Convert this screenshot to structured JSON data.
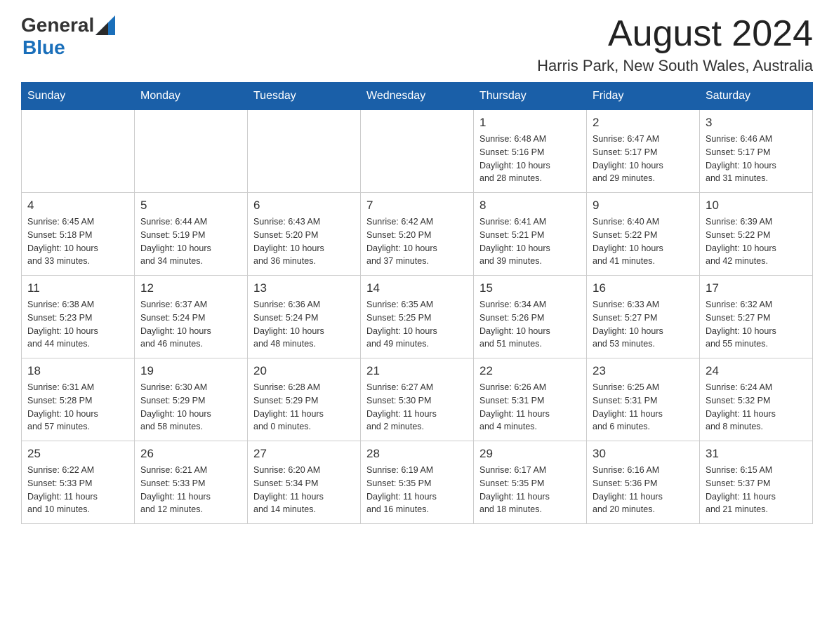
{
  "header": {
    "logo_general": "General",
    "logo_blue": "Blue",
    "month_title": "August 2024",
    "location": "Harris Park, New South Wales, Australia"
  },
  "weekdays": [
    "Sunday",
    "Monday",
    "Tuesday",
    "Wednesday",
    "Thursday",
    "Friday",
    "Saturday"
  ],
  "weeks": [
    [
      {
        "day": "",
        "info": ""
      },
      {
        "day": "",
        "info": ""
      },
      {
        "day": "",
        "info": ""
      },
      {
        "day": "",
        "info": ""
      },
      {
        "day": "1",
        "info": "Sunrise: 6:48 AM\nSunset: 5:16 PM\nDaylight: 10 hours\nand 28 minutes."
      },
      {
        "day": "2",
        "info": "Sunrise: 6:47 AM\nSunset: 5:17 PM\nDaylight: 10 hours\nand 29 minutes."
      },
      {
        "day": "3",
        "info": "Sunrise: 6:46 AM\nSunset: 5:17 PM\nDaylight: 10 hours\nand 31 minutes."
      }
    ],
    [
      {
        "day": "4",
        "info": "Sunrise: 6:45 AM\nSunset: 5:18 PM\nDaylight: 10 hours\nand 33 minutes."
      },
      {
        "day": "5",
        "info": "Sunrise: 6:44 AM\nSunset: 5:19 PM\nDaylight: 10 hours\nand 34 minutes."
      },
      {
        "day": "6",
        "info": "Sunrise: 6:43 AM\nSunset: 5:20 PM\nDaylight: 10 hours\nand 36 minutes."
      },
      {
        "day": "7",
        "info": "Sunrise: 6:42 AM\nSunset: 5:20 PM\nDaylight: 10 hours\nand 37 minutes."
      },
      {
        "day": "8",
        "info": "Sunrise: 6:41 AM\nSunset: 5:21 PM\nDaylight: 10 hours\nand 39 minutes."
      },
      {
        "day": "9",
        "info": "Sunrise: 6:40 AM\nSunset: 5:22 PM\nDaylight: 10 hours\nand 41 minutes."
      },
      {
        "day": "10",
        "info": "Sunrise: 6:39 AM\nSunset: 5:22 PM\nDaylight: 10 hours\nand 42 minutes."
      }
    ],
    [
      {
        "day": "11",
        "info": "Sunrise: 6:38 AM\nSunset: 5:23 PM\nDaylight: 10 hours\nand 44 minutes."
      },
      {
        "day": "12",
        "info": "Sunrise: 6:37 AM\nSunset: 5:24 PM\nDaylight: 10 hours\nand 46 minutes."
      },
      {
        "day": "13",
        "info": "Sunrise: 6:36 AM\nSunset: 5:24 PM\nDaylight: 10 hours\nand 48 minutes."
      },
      {
        "day": "14",
        "info": "Sunrise: 6:35 AM\nSunset: 5:25 PM\nDaylight: 10 hours\nand 49 minutes."
      },
      {
        "day": "15",
        "info": "Sunrise: 6:34 AM\nSunset: 5:26 PM\nDaylight: 10 hours\nand 51 minutes."
      },
      {
        "day": "16",
        "info": "Sunrise: 6:33 AM\nSunset: 5:27 PM\nDaylight: 10 hours\nand 53 minutes."
      },
      {
        "day": "17",
        "info": "Sunrise: 6:32 AM\nSunset: 5:27 PM\nDaylight: 10 hours\nand 55 minutes."
      }
    ],
    [
      {
        "day": "18",
        "info": "Sunrise: 6:31 AM\nSunset: 5:28 PM\nDaylight: 10 hours\nand 57 minutes."
      },
      {
        "day": "19",
        "info": "Sunrise: 6:30 AM\nSunset: 5:29 PM\nDaylight: 10 hours\nand 58 minutes."
      },
      {
        "day": "20",
        "info": "Sunrise: 6:28 AM\nSunset: 5:29 PM\nDaylight: 11 hours\nand 0 minutes."
      },
      {
        "day": "21",
        "info": "Sunrise: 6:27 AM\nSunset: 5:30 PM\nDaylight: 11 hours\nand 2 minutes."
      },
      {
        "day": "22",
        "info": "Sunrise: 6:26 AM\nSunset: 5:31 PM\nDaylight: 11 hours\nand 4 minutes."
      },
      {
        "day": "23",
        "info": "Sunrise: 6:25 AM\nSunset: 5:31 PM\nDaylight: 11 hours\nand 6 minutes."
      },
      {
        "day": "24",
        "info": "Sunrise: 6:24 AM\nSunset: 5:32 PM\nDaylight: 11 hours\nand 8 minutes."
      }
    ],
    [
      {
        "day": "25",
        "info": "Sunrise: 6:22 AM\nSunset: 5:33 PM\nDaylight: 11 hours\nand 10 minutes."
      },
      {
        "day": "26",
        "info": "Sunrise: 6:21 AM\nSunset: 5:33 PM\nDaylight: 11 hours\nand 12 minutes."
      },
      {
        "day": "27",
        "info": "Sunrise: 6:20 AM\nSunset: 5:34 PM\nDaylight: 11 hours\nand 14 minutes."
      },
      {
        "day": "28",
        "info": "Sunrise: 6:19 AM\nSunset: 5:35 PM\nDaylight: 11 hours\nand 16 minutes."
      },
      {
        "day": "29",
        "info": "Sunrise: 6:17 AM\nSunset: 5:35 PM\nDaylight: 11 hours\nand 18 minutes."
      },
      {
        "day": "30",
        "info": "Sunrise: 6:16 AM\nSunset: 5:36 PM\nDaylight: 11 hours\nand 20 minutes."
      },
      {
        "day": "31",
        "info": "Sunrise: 6:15 AM\nSunset: 5:37 PM\nDaylight: 11 hours\nand 21 minutes."
      }
    ]
  ]
}
